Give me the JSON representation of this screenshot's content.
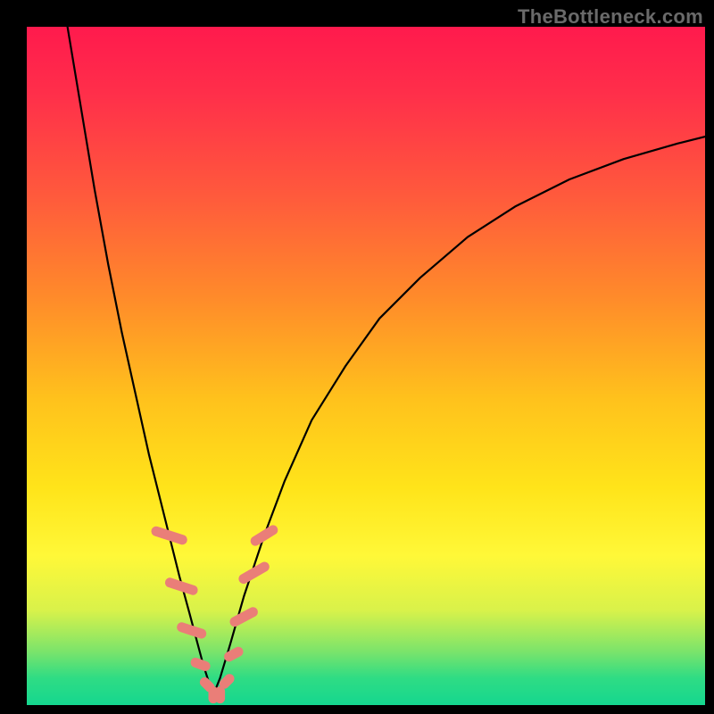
{
  "watermark": {
    "text": "TheBottleneck.com"
  },
  "colors": {
    "curve_stroke": "#000000",
    "marker_fill": "#ea7e78",
    "marker_stroke": "#ea7e78",
    "frame": "#000000"
  },
  "chart_data": {
    "type": "line",
    "title": "",
    "xlabel": "",
    "ylabel": "",
    "xlim": [
      0,
      100
    ],
    "ylim": [
      0,
      100
    ],
    "grid": false,
    "legend": false,
    "axes_visible": false,
    "note": "Values estimated from pixel positions on a 0–100 normalized scale; chart has no tick labels.",
    "series": [
      {
        "name": "left-branch",
        "x": [
          6,
          8,
          10,
          12,
          14,
          16,
          18,
          19.5,
          21,
          22.5,
          24,
          25.2,
          26,
          26.8,
          27.5
        ],
        "y": [
          100,
          88,
          76,
          65,
          55,
          46,
          37,
          31,
          25,
          19,
          13.5,
          9,
          6,
          3.5,
          1.5
        ]
      },
      {
        "name": "right-branch",
        "x": [
          27.5,
          28.5,
          30,
          32,
          35,
          38,
          42,
          47,
          52,
          58,
          65,
          72,
          80,
          88,
          96,
          100
        ],
        "y": [
          1.5,
          4,
          9,
          16,
          25,
          33,
          42,
          50,
          57,
          63,
          69,
          73.5,
          77.5,
          80.5,
          82.8,
          83.8
        ]
      }
    ],
    "markers": {
      "name": "salmon-pill-markers",
      "note": "Elongated rounded markers near the dip on both branches.",
      "points": [
        {
          "x": 21.0,
          "y": 25.0,
          "len": 5.5,
          "angle": -72
        },
        {
          "x": 22.8,
          "y": 17.5,
          "len": 5.0,
          "angle": -72
        },
        {
          "x": 24.3,
          "y": 11.0,
          "len": 4.5,
          "angle": -72
        },
        {
          "x": 25.6,
          "y": 6.0,
          "len": 3.0,
          "angle": -70
        },
        {
          "x": 26.6,
          "y": 3.0,
          "len": 2.5,
          "angle": -45
        },
        {
          "x": 27.5,
          "y": 1.5,
          "len": 2.5,
          "angle": 0
        },
        {
          "x": 28.5,
          "y": 1.5,
          "len": 2.5,
          "angle": 0
        },
        {
          "x": 29.5,
          "y": 3.5,
          "len": 2.5,
          "angle": 45
        },
        {
          "x": 30.5,
          "y": 7.5,
          "len": 3.0,
          "angle": 62
        },
        {
          "x": 32.0,
          "y": 13.0,
          "len": 4.5,
          "angle": 62
        },
        {
          "x": 33.5,
          "y": 19.5,
          "len": 5.0,
          "angle": 60
        },
        {
          "x": 35.0,
          "y": 25.0,
          "len": 4.5,
          "angle": 58
        }
      ]
    }
  }
}
